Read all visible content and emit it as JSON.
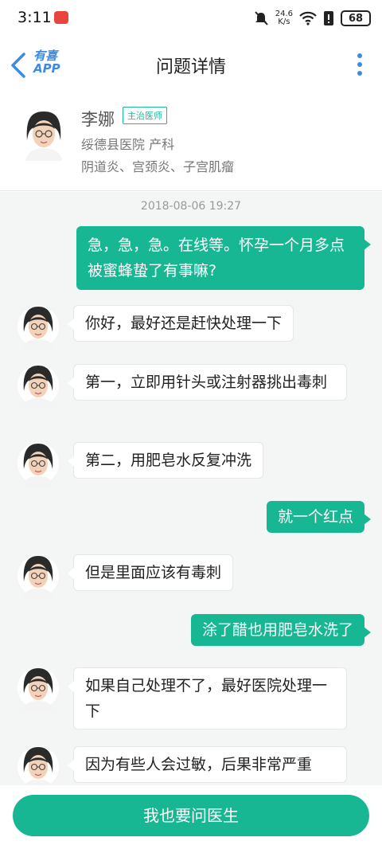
{
  "status_bar": {
    "time": "3:11",
    "speed_value": "24.6",
    "speed_unit": "K/s",
    "battery": "68"
  },
  "nav": {
    "logo_line1": "有喜",
    "logo_line2": "APP",
    "title": "问题详情"
  },
  "doctor": {
    "name": "李娜",
    "tag": "主治医师",
    "hospital": "绥德县医院 产科",
    "specialty": "阴道炎、宫颈炎、子宫肌瘤"
  },
  "chat": {
    "timestamp": "2018-08-06 19:27",
    "messages": [
      {
        "from": "user",
        "text": "急，急，急。在线等。怀孕一个月多点被蜜蜂蛰了有事嘛?"
      },
      {
        "from": "doctor",
        "text": "你好，最好还是赶快处理一下"
      },
      {
        "from": "doctor",
        "text": "第一，立即用针头或注射器挑出毒刺"
      },
      {
        "from": "doctor",
        "text": "第二，用肥皂水反复冲洗"
      },
      {
        "from": "user",
        "text": "就一个红点"
      },
      {
        "from": "doctor",
        "text": "但是里面应该有毒刺"
      },
      {
        "from": "user",
        "text": "涂了醋也用肥皂水洗了"
      },
      {
        "from": "doctor",
        "text": "如果自己处理不了，最好医院处理一下"
      },
      {
        "from": "doctor",
        "text": "因为有些人会过敏，后果非常严重"
      }
    ]
  },
  "bottom": {
    "ask_label": "我也要问医生"
  },
  "colors": {
    "accent": "#17b794",
    "link_blue": "#3b8be6"
  }
}
